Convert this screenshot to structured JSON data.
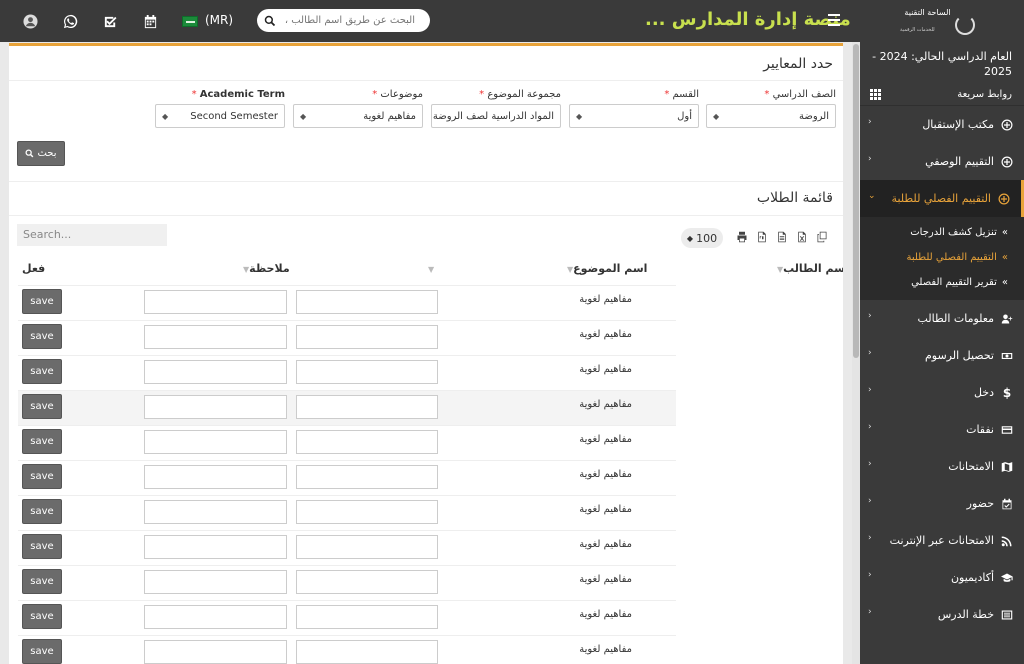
{
  "topbar": {
    "currency": "(MR)",
    "search_placeholder": "البحث عن طريق اسم الطالب ، ،",
    "app_title": "منصة إدارة المدارس ...",
    "logo_title": "الساحة التقنية",
    "logo_subtitle": "للخدمات الرقمية"
  },
  "criteria": {
    "title": "حدد المعايير",
    "filters": [
      {
        "label": "الصف الدراسي",
        "value": "الروضة"
      },
      {
        "label": "القسم",
        "value": "أول"
      },
      {
        "label": "مجموعة الموضوع",
        "value": "المواد الدراسية لصف الروضة"
      },
      {
        "label": "موضوعات",
        "value": "مفاهيم لغوية"
      },
      {
        "label": "Academic Term",
        "value": "Second Semester"
      }
    ],
    "required_mark": "*",
    "search_button": "بحث"
  },
  "students": {
    "title": "قائمة الطلاب",
    "search_placeholder": "Search...",
    "page_size": "100",
    "columns": {
      "student_name": "اسم الطالب",
      "subject_name": "اسم الموضوع",
      "note": "ملاحظة",
      "action": "فعل"
    },
    "rows": [
      {
        "subject": "مفاهيم لغوية",
        "save": "save"
      },
      {
        "subject": "مفاهيم لغوية",
        "save": "save"
      },
      {
        "subject": "مفاهيم لغوية",
        "save": "save"
      },
      {
        "subject": "مفاهيم لغوية",
        "save": "save"
      },
      {
        "subject": "مفاهيم لغوية",
        "save": "save"
      },
      {
        "subject": "مفاهيم لغوية",
        "save": "save"
      },
      {
        "subject": "مفاهيم لغوية",
        "save": "save"
      },
      {
        "subject": "مفاهيم لغوية",
        "save": "save"
      },
      {
        "subject": "مفاهيم لغوية",
        "save": "save"
      },
      {
        "subject": "مفاهيم لغوية",
        "save": "save"
      },
      {
        "subject": "مفاهيم لغوية",
        "save": "save"
      }
    ]
  },
  "sidebar": {
    "academic_year": "العام الدراسي الحالي: 2024 - 2025",
    "quick_links": "روابط سريعة",
    "items": [
      {
        "label": "مكتب الإستقبال",
        "icon": "reception-icon"
      },
      {
        "label": "التقييم الوصفي",
        "icon": "assessment-icon"
      },
      {
        "label": "التقييم الفصلي للطلبة",
        "icon": "term-assessment-icon"
      },
      {
        "label": "معلومات الطالب",
        "icon": "user-plus-icon"
      },
      {
        "label": "تحصيل الرسوم",
        "icon": "money-icon"
      },
      {
        "label": "دخل",
        "icon": "dollar-icon"
      },
      {
        "label": "نفقات",
        "icon": "credit-card-icon"
      },
      {
        "label": "الامتحانات",
        "icon": "map-icon"
      },
      {
        "label": "حضور",
        "icon": "calendar-check-icon"
      },
      {
        "label": "الامتحانات عبر الإنترنت",
        "icon": "rss-icon"
      },
      {
        "label": "أكاديميون",
        "icon": "graduation-cap-icon"
      },
      {
        "label": "خطة الدرس",
        "icon": "list-icon"
      }
    ],
    "submenu": [
      {
        "label": "تنزيل كشف الدرجات"
      },
      {
        "label": "التقييم الفصلي للطلبة"
      },
      {
        "label": "تقرير التقييم الفصلي"
      }
    ]
  },
  "colors": {
    "accent": "#e8a33a",
    "title_green": "#c8e04e",
    "dark": "#3a3a3a"
  }
}
